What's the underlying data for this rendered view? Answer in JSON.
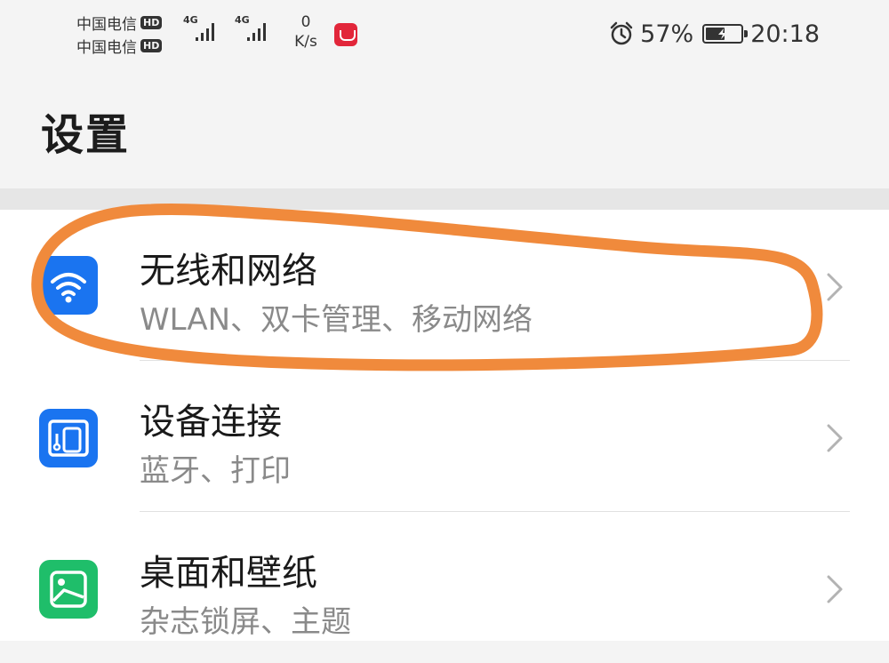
{
  "status_bar": {
    "carriers": [
      {
        "name": "中国电信",
        "badge": "HD",
        "network": "4G"
      },
      {
        "name": "中国电信",
        "badge": "HD",
        "network": "4G"
      }
    ],
    "net_speed_value": "0",
    "net_speed_unit": "K/s",
    "notification_icon": "app-notification-icon",
    "alarm_icon": "alarm-clock-icon",
    "battery_percent": "57%",
    "battery_level": 0.57,
    "battery_charging": true,
    "time": "20:18"
  },
  "page": {
    "title": "设置"
  },
  "settings_items": [
    {
      "title": "无线和网络",
      "subtitle": "WLAN、双卡管理、移动网络",
      "icon": "wifi-icon",
      "icon_color": "#1a74f0"
    },
    {
      "title": "设备连接",
      "subtitle": "蓝牙、打印",
      "icon": "device-connection-icon",
      "icon_color": "#1a74f0"
    },
    {
      "title": "桌面和壁纸",
      "subtitle": "杂志锁屏、主题",
      "icon": "wallpaper-icon",
      "icon_color": "#1fbe6a"
    }
  ],
  "annotation": {
    "color": "#f08a3c",
    "target": "settings_items.0"
  },
  "colors": {
    "background": "#f4f4f4",
    "list_background": "#ffffff",
    "subtitle": "#8a8a8a"
  }
}
